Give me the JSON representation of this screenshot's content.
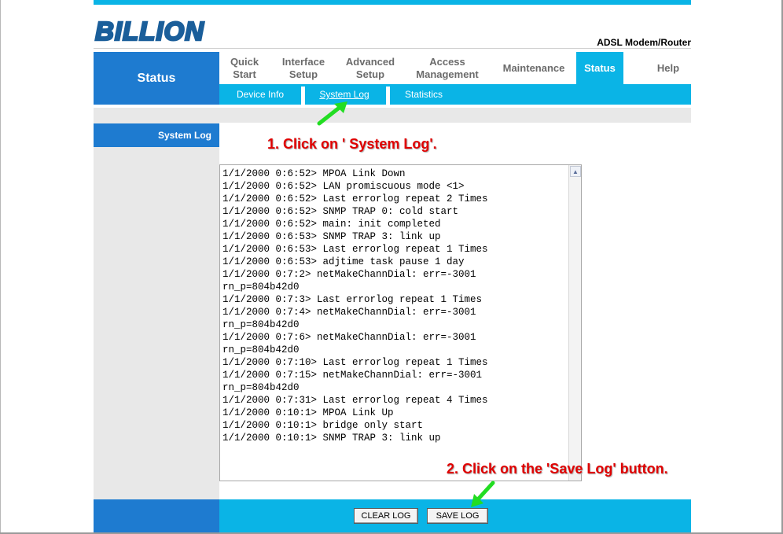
{
  "header": {
    "logo_text": "BILLION",
    "product": "ADSL Modem/Router"
  },
  "sidebar": {
    "title": "Status",
    "items": [
      {
        "label": "System Log"
      }
    ]
  },
  "nav": {
    "items": [
      {
        "label": "Quick\nStart"
      },
      {
        "label": "Interface\nSetup"
      },
      {
        "label": "Advanced\nSetup"
      },
      {
        "label": "Access\nManagement"
      },
      {
        "label": "Maintenance"
      },
      {
        "label": "Status"
      },
      {
        "label": "Help"
      }
    ],
    "active": "Status"
  },
  "subnav": {
    "items": [
      {
        "label": "Device Info"
      },
      {
        "label": "System Log"
      },
      {
        "label": "Statistics"
      }
    ]
  },
  "log": {
    "lines": [
      "1/1/2000 0:6:52> MPOA Link Down",
      "1/1/2000 0:6:52> LAN promiscuous mode <1>",
      "1/1/2000 0:6:52> Last errorlog repeat 2 Times",
      "1/1/2000 0:6:52> SNMP TRAP 0: cold start",
      "1/1/2000 0:6:52> main: init completed",
      "1/1/2000 0:6:53> SNMP TRAP 3: link up",
      "1/1/2000 0:6:53> Last errorlog repeat 1 Times",
      "1/1/2000 0:6:53> adjtime task pause 1 day",
      "1/1/2000 0:7:2> netMakeChannDial: err=-3001",
      "rn_p=804b42d0",
      "1/1/2000 0:7:3> Last errorlog repeat 1 Times",
      "1/1/2000 0:7:4> netMakeChannDial: err=-3001",
      "rn_p=804b42d0",
      "1/1/2000 0:7:6> netMakeChannDial: err=-3001",
      "rn_p=804b42d0",
      "1/1/2000 0:7:10> Last errorlog repeat 1 Times",
      "1/1/2000 0:7:15> netMakeChannDial: err=-3001",
      "rn_p=804b42d0",
      "1/1/2000 0:7:31> Last errorlog repeat 4 Times",
      "1/1/2000 0:10:1> MPOA Link Up",
      "1/1/2000 0:10:1> bridge only start",
      "1/1/2000 0:10:1> SNMP TRAP 3: link up"
    ]
  },
  "buttons": {
    "clear_log": "CLEAR LOG",
    "save_log": "SAVE LOG"
  },
  "annotations": {
    "step1": "1. Click on ' System Log'.",
    "step2": "2. Click on the 'Save Log' button.",
    "color": "#e00000",
    "arrow_color": "#22dd22"
  },
  "colors": {
    "accent_cyan": "#0ab4e6",
    "accent_blue": "#1e7bd0",
    "panel_grey": "#e8e8e8"
  }
}
